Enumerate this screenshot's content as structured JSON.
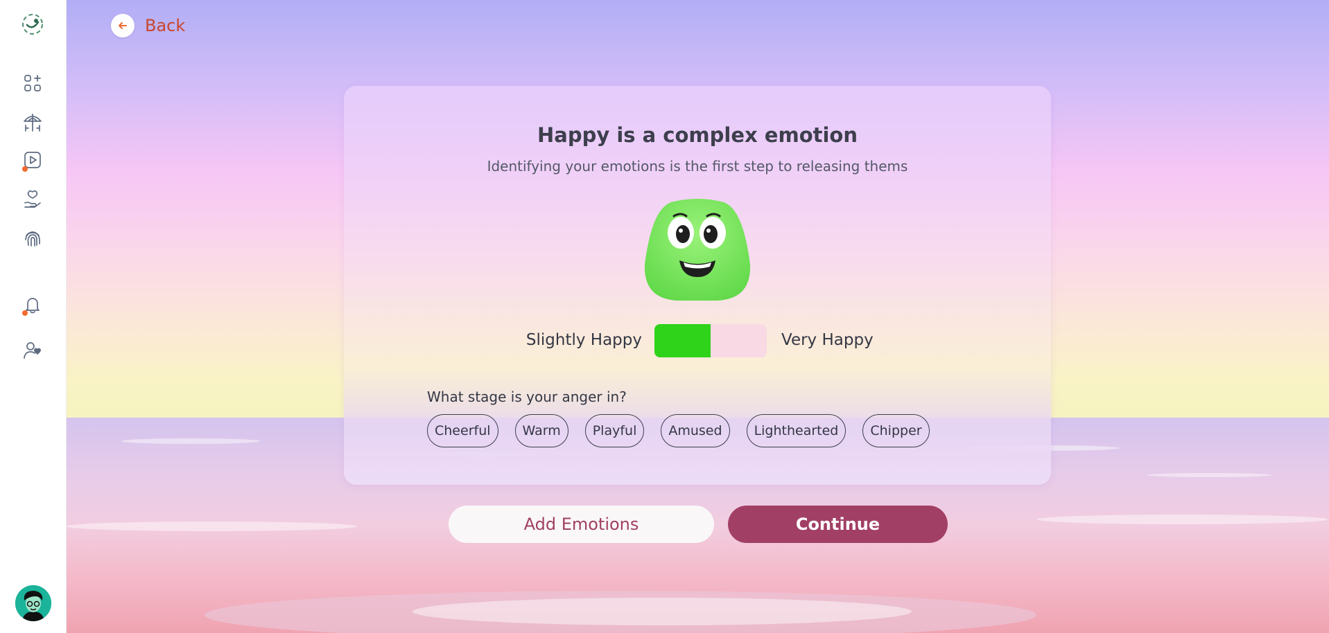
{
  "back": {
    "label": "Back"
  },
  "card": {
    "title": "Happy is a complex emotion",
    "subtitle": "Identifying your emotions is the first step to releasing thems",
    "slider": {
      "left_label": "Slightly Happy",
      "right_label": "Very Happy",
      "level_percent": 50
    },
    "stage_question": "What stage is your anger in?",
    "chips": [
      "Cheerful",
      "Warm",
      "Playful",
      "Amused",
      "Lighthearted",
      "Chipper"
    ]
  },
  "buttons": {
    "add_emotions": "Add Emotions",
    "continue": "Continue"
  },
  "sidebar": {
    "icons": [
      "logo-icon",
      "dashboard-icon",
      "umbrella-icon",
      "video-icon",
      "care-hand-icon",
      "fingerprint-icon",
      "bell-icon",
      "user-heart-icon"
    ],
    "notification_dot_color": "#f26b2e"
  },
  "colors": {
    "accent": "#a23f65",
    "slider_fill": "#2ed31a",
    "back_text": "#c8462b"
  }
}
